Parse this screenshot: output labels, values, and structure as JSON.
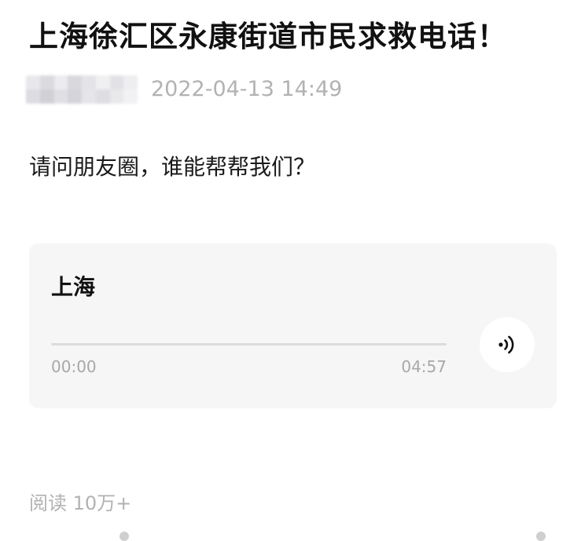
{
  "article": {
    "title": "上海徐汇区永康街道市民求救电话！",
    "timestamp": "2022-04-13 14:49",
    "body": "请问朋友圈，谁能帮帮我们？"
  },
  "audio": {
    "title": "上海",
    "current_time": "00:00",
    "total_time": "04:57",
    "progress": 0,
    "play_icon": "audio-wave-icon"
  },
  "footer": {
    "read_count": "阅读 10万+"
  },
  "colors": {
    "text_primary": "#111111",
    "text_muted": "#b2b2b2",
    "card_bg": "#f6f6f6",
    "track": "#dcdcdc"
  }
}
